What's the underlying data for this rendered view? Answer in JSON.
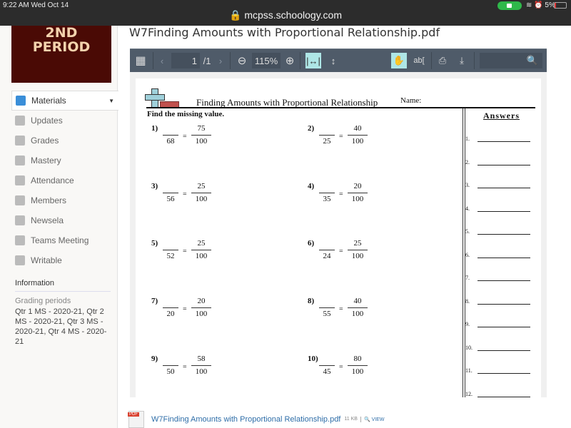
{
  "status": {
    "time": "9:22 AM   Wed Oct 14",
    "url": "mcpss.schoology.com",
    "battery": "5%"
  },
  "sidebar": {
    "logo": "2ND PERIOD",
    "items": [
      {
        "label": "Materials",
        "icon": "materials-icon",
        "active": true
      },
      {
        "label": "Updates",
        "icon": "updates-icon"
      },
      {
        "label": "Grades",
        "icon": "grades-icon"
      },
      {
        "label": "Mastery",
        "icon": "mastery-icon"
      },
      {
        "label": "Attendance",
        "icon": "attendance-icon"
      },
      {
        "label": "Members",
        "icon": "members-icon"
      },
      {
        "label": "Newsela",
        "icon": "newsela-icon"
      },
      {
        "label": "Teams Meeting",
        "icon": "teams-icon"
      },
      {
        "label": "Writable",
        "icon": "writable-icon"
      }
    ],
    "info_heading": "Information",
    "grading_label": "Grading periods",
    "grading_value": "Qtr 1 MS - 2020-21, Qtr 2 MS - 2020-21, Qtr 3 MS - 2020-21, Qtr 4 MS - 2020-21"
  },
  "main": {
    "title": "W7Finding Amounts with Proportional Relationship.pdf"
  },
  "toolbar": {
    "page": "1",
    "total": "/1",
    "zoom": "115%",
    "search_placeholder": ""
  },
  "worksheet": {
    "title": "Finding Amounts with Proportional Relationship",
    "name_label": "Name:",
    "instruction": "Find the missing value.",
    "answers_heading": "Answers",
    "problems": [
      {
        "n": "1)",
        "den": "68",
        "rn": "75",
        "rd": "100"
      },
      {
        "n": "2)",
        "den": "25",
        "rn": "40",
        "rd": "100"
      },
      {
        "n": "3)",
        "den": "56",
        "rn": "25",
        "rd": "100"
      },
      {
        "n": "4)",
        "den": "35",
        "rn": "20",
        "rd": "100"
      },
      {
        "n": "5)",
        "den": "52",
        "rn": "25",
        "rd": "100"
      },
      {
        "n": "6)",
        "den": "24",
        "rn": "25",
        "rd": "100"
      },
      {
        "n": "7)",
        "den": "20",
        "rn": "20",
        "rd": "100"
      },
      {
        "n": "8)",
        "den": "55",
        "rn": "40",
        "rd": "100"
      },
      {
        "n": "9)",
        "den": "50",
        "rn": "58",
        "rd": "100"
      },
      {
        "n": "10)",
        "den": "45",
        "rn": "80",
        "rd": "100"
      }
    ],
    "answer_numbers": [
      "1.",
      "2.",
      "3.",
      "4.",
      "5.",
      "6.",
      "7.",
      "8.",
      "9.",
      "10.",
      "11.",
      "12."
    ]
  },
  "footer": {
    "file": "W7Finding Amounts with Proportional Relationship.pdf",
    "size": "11 KB",
    "view": "VIEW"
  }
}
